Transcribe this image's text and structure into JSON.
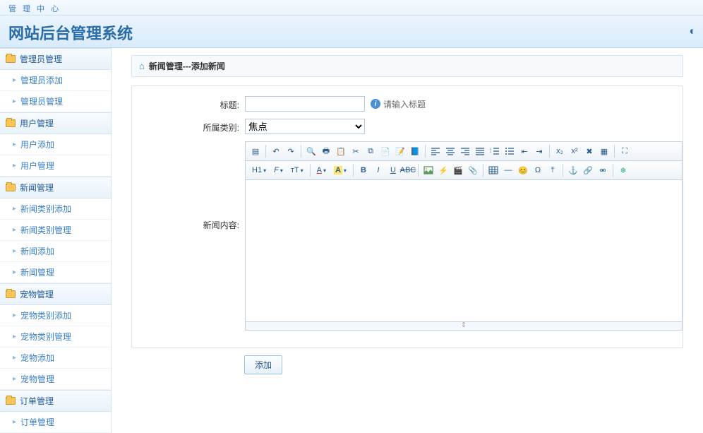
{
  "top_nav": "管 理 中 心",
  "header_title": "网站后台管理系统",
  "sidebar": {
    "groups": [
      {
        "label": "管理员管理",
        "items": [
          "管理员添加",
          "管理员管理"
        ]
      },
      {
        "label": "用户管理",
        "items": [
          "用户添加",
          "用户管理"
        ]
      },
      {
        "label": "新闻管理",
        "items": [
          "新闻类别添加",
          "新闻类别管理",
          "新闻添加",
          "新闻管理"
        ]
      },
      {
        "label": "宠物管理",
        "items": [
          "宠物类别添加",
          "宠物类别管理",
          "宠物添加",
          "宠物管理"
        ]
      },
      {
        "label": "订单管理",
        "items": [
          "订单管理"
        ]
      }
    ]
  },
  "breadcrumb": "新闻管理---添加新闻",
  "form": {
    "title_label": "标题:",
    "title_value": "",
    "title_hint": "请输入标题",
    "category_label": "所属类别:",
    "category_value": "焦点",
    "category_options": [
      "焦点"
    ],
    "content_label": "新闻内容:",
    "content_value": "",
    "submit_label": "添加"
  },
  "editor": {
    "heading_sel": "H1",
    "font_sel": "F",
    "size_sel": "тT",
    "color_sel": "A",
    "hilite_sel": "A"
  }
}
